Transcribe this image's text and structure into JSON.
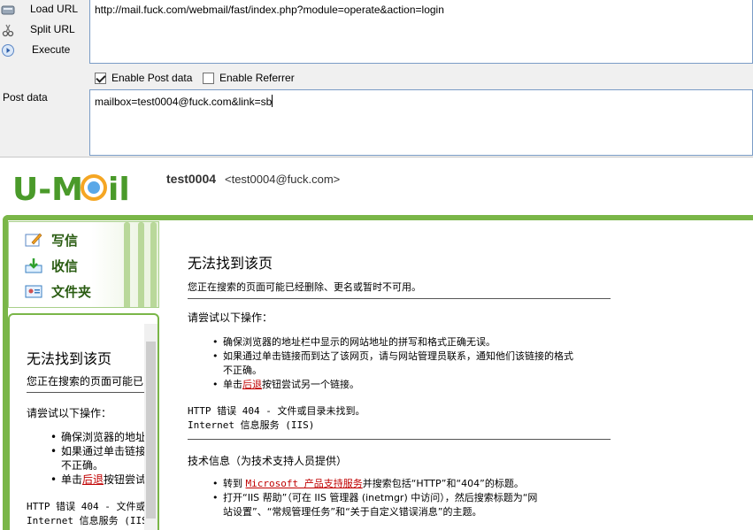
{
  "hackbar": {
    "load_url": "Load URL",
    "split_url": "Split URL",
    "execute": "Execute",
    "url_value": "http://mail.fuck.com/webmail/fast/index.php?module=operate&action=login",
    "enable_post": "Enable Post data",
    "enable_post_checked": true,
    "enable_referrer": "Enable Referrer",
    "enable_referrer_checked": false,
    "post_label": "Post data",
    "post_value": "mailbox=test0004@fuck.com&link=sb"
  },
  "header": {
    "logo_text": "U-Mail",
    "user_name": "test0004",
    "user_email": "<test0004@fuck.com>"
  },
  "menu": {
    "items": [
      {
        "label": "写信",
        "icon": "compose-icon"
      },
      {
        "label": "收信",
        "icon": "inbox-icon"
      },
      {
        "label": "文件夹",
        "icon": "folder-icon"
      }
    ]
  },
  "error": {
    "title": "无法找到该页",
    "subtitle": "您正在搜索的页面可能已经删除、更名或暂时不可用。",
    "try_heading": "请尝试以下操作：",
    "tips": [
      "确保浏览器的地址栏中显示的网站地址的拼写和格式正确无误。",
      "如果通过单击链接而到达了该网页，请与网站管理员联系，通知他们该链接的格式",
      "不正确。"
    ],
    "back_prefix": "单击",
    "back_link": "后退",
    "back_suffix": "按钮尝试另一个链接。",
    "http_error": "HTTP 错误 404 - 文件或目录未找到。",
    "iis_service": "Internet 信息服务 (IIS)",
    "tech_info": "技术信息（为技术支持人员提供）",
    "goto_prefix": "转到 ",
    "ms_link": "Microsoft 产品支持服务",
    "goto_suffix": "并搜索包括“HTTP”和“404”的标题。",
    "iis_help_1": "打开“IIS 帮助”（可在 IIS 管理器 (inetmgr) 中访问），然后搜索标题为“网",
    "iis_help_2": "站设置”、“常规管理任务”和“关于自定义错误消息”的主题。"
  },
  "left_frame": {
    "title": "无法找到该页",
    "subtitle": "您正在搜索的页面可能已",
    "try_heading": "请尝试以下操作：",
    "tips": [
      "确保浏览器的地址",
      "如果通过单击链接",
      "不正确。"
    ],
    "back_prefix": "单击",
    "back_link": "后退",
    "back_suffix": "按钮尝试",
    "http_error": "HTTP 错误 404 - 文件或",
    "iis_service": "Internet 信息服务 (IIS"
  }
}
